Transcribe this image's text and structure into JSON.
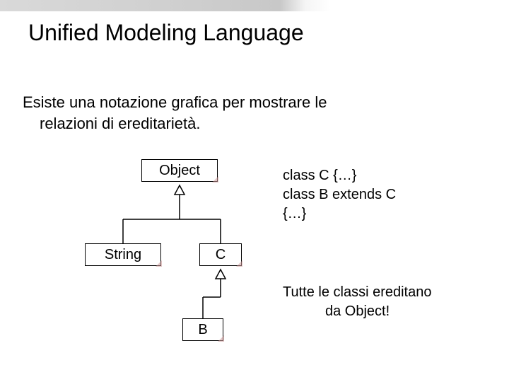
{
  "title": "Unified Modeling Language",
  "subtitle_line1": "Esiste una notazione grafica per mostrare le",
  "subtitle_line2": "relazioni di ereditarietà.",
  "boxes": {
    "object": "Object",
    "string": "String",
    "c": "C",
    "b": "B"
  },
  "code": {
    "line1": "class C {…}",
    "line2": "class B extends C",
    "line3": "{…}"
  },
  "note": {
    "line1": "Tutte le classi ereditano",
    "line2": "da Object!"
  }
}
